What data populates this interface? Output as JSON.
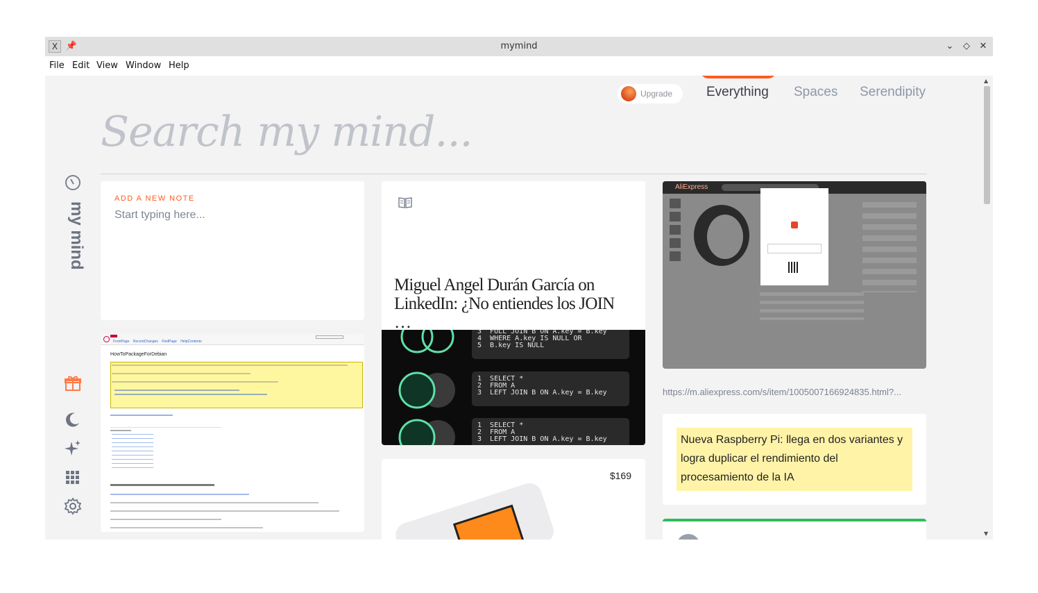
{
  "window": {
    "title": "mymind",
    "app_icon": "X",
    "controls": [
      "chevron-down-icon",
      "restore-icon",
      "close-icon"
    ]
  },
  "menubar": {
    "items": [
      "File",
      "Edit",
      "View",
      "Window",
      "Help"
    ]
  },
  "header": {
    "upgrade_label": "Upgrade",
    "tabs": [
      {
        "label": "Everything",
        "active": true
      },
      {
        "label": "Spaces",
        "active": false
      },
      {
        "label": "Serendipity",
        "active": false
      }
    ],
    "accent_color": "#ff5a1f"
  },
  "search": {
    "placeholder": "Search my mind..."
  },
  "sidebar": {
    "brand": "my mind",
    "icons": [
      "gift-icon",
      "moon-icon",
      "sparkles-icon",
      "grid-icon",
      "gear-icon"
    ]
  },
  "cards": {
    "note": {
      "label": "ADD A NEW NOTE",
      "placeholder": "Start typing here..."
    },
    "article": {
      "icon": "book-icon",
      "title": "Miguel Angel Durán García on LinkedIn: ¿No entiendes los JOIN …",
      "code": [
        {
          "lines": [
            "3  FULL JOIN B ON A.key = B.key",
            "4  WHERE A.key IS NULL OR",
            "5  B.key IS NULL"
          ]
        },
        {
          "lines": [
            "1  SELECT *",
            "2  FROM A",
            "3  LEFT JOIN B ON A.key = B.key"
          ]
        },
        {
          "lines": [
            "1  SELECT *",
            "2  FROM A",
            "3  LEFT JOIN B ON A.key = B.key"
          ]
        }
      ]
    },
    "aliexpress": {
      "brand": "AliExpress",
      "url": "https://m.aliexpress.com/s/item/1005007166924835.html?..."
    },
    "quote": {
      "text": "Nueva Raspberry Pi: llega en dos variantes y logra duplicar el rendimiento del procesamiento de la IA"
    },
    "product": {
      "price": "$169"
    },
    "wiki": {
      "title": "HowToPackageForDebian"
    }
  }
}
